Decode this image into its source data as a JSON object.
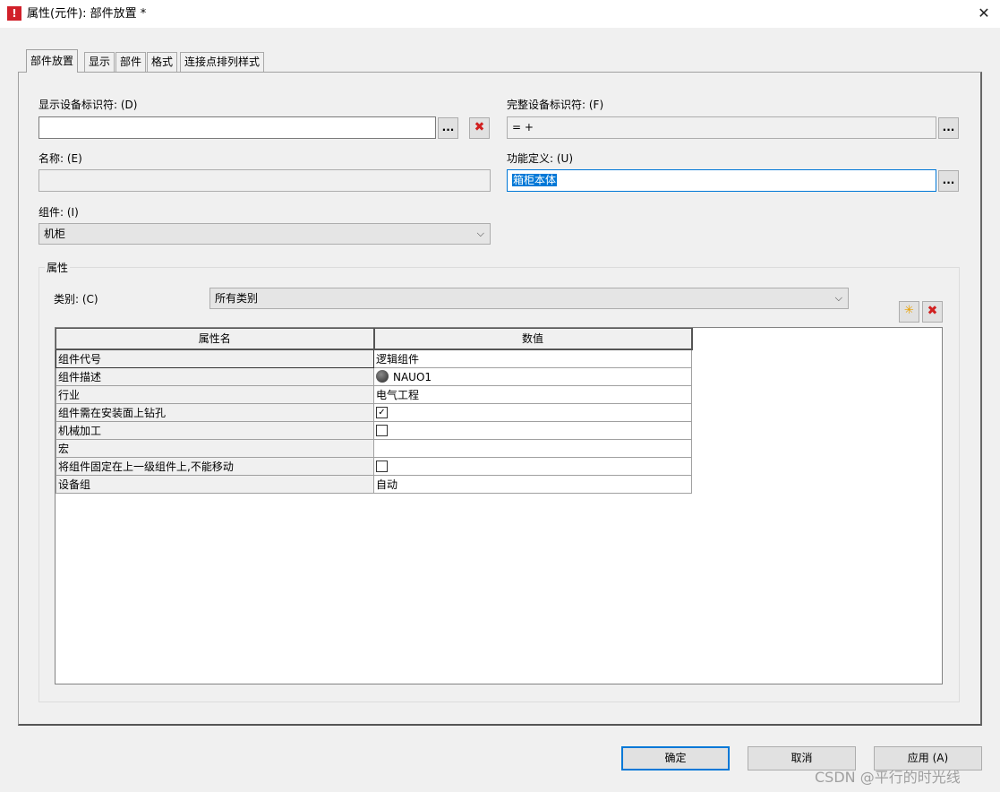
{
  "window": {
    "title": "属性(元件): 部件放置 *",
    "close_glyph": "✕",
    "app_icon_glyph": "!"
  },
  "tabs": [
    "部件放置",
    "显示",
    "部件",
    "格式",
    "连接点排列样式"
  ],
  "fields": {
    "display_id": {
      "label": "显示设备标识符: (D)",
      "value": ""
    },
    "full_id": {
      "label": "完整设备标识符: (F)",
      "value": "= +"
    },
    "name": {
      "label": "名称: (E)",
      "value": ""
    },
    "function_def": {
      "label": "功能定义: (U)",
      "value": "箱柜本体"
    },
    "component": {
      "label": "组件: (I)",
      "value": "机柜"
    }
  },
  "browse_label": "...",
  "delete_glyph": "✖",
  "chevron_glyph": "⌵",
  "properties": {
    "group_label": "属性",
    "category_label": "类别: (C)",
    "category_value": "所有类别",
    "new_icon_glyph": "✳",
    "delete_icon_glyph": "✖",
    "headers": {
      "name": "属性名",
      "value": "数值"
    },
    "rows": [
      {
        "name": "组件代号",
        "value": "逻辑组件",
        "kind": "text"
      },
      {
        "name": "组件描述",
        "value": "NAUO1",
        "kind": "globe"
      },
      {
        "name": "行业",
        "value": "电气工程",
        "kind": "text"
      },
      {
        "name": "组件需在安装面上钻孔",
        "value": "checked",
        "kind": "check"
      },
      {
        "name": "机械加工",
        "value": "unchecked",
        "kind": "check"
      },
      {
        "name": "宏",
        "value": "",
        "kind": "text"
      },
      {
        "name": "将组件固定在上一级组件上,不能移动",
        "value": "unchecked",
        "kind": "check"
      },
      {
        "name": "设备组",
        "value": "自动",
        "kind": "text"
      }
    ]
  },
  "footer": {
    "ok": "确定",
    "cancel": "取消",
    "apply": "应用 (A)"
  },
  "watermark": "CSDN @平行的时光线",
  "colors": {
    "accent": "#0078d7",
    "danger": "#d12020",
    "brand": "#d1202a"
  }
}
